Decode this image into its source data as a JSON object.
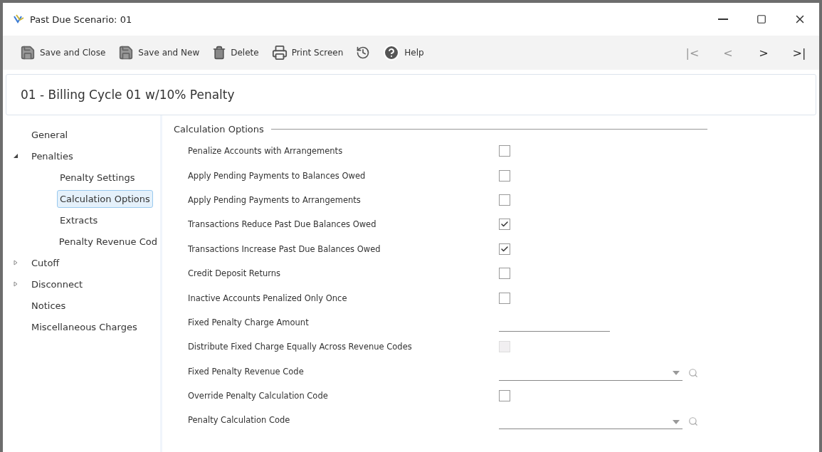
{
  "window": {
    "title": "Past Due Scenario: 01"
  },
  "toolbar": {
    "buttons": [
      {
        "kind": "save-close",
        "label": "Save and Close"
      },
      {
        "kind": "save-new",
        "label": "Save and New"
      },
      {
        "kind": "delete",
        "label": "Delete"
      },
      {
        "kind": "print",
        "label": "Print Screen"
      },
      {
        "kind": "history"
      },
      {
        "kind": "help",
        "label": "Help"
      }
    ],
    "navigation": [
      {
        "kind": "first",
        "label": "|<"
      },
      {
        "kind": "prev",
        "label": "<"
      },
      {
        "kind": "next",
        "label": ">"
      },
      {
        "kind": "last",
        "label": ">|"
      }
    ]
  },
  "record_title": "01 - Billing Cycle 01 w/10% Penalty",
  "sidebar": {
    "items": [
      {
        "label": "General",
        "selected": false
      },
      {
        "label": "Penalties",
        "selected": false,
        "expanded": true,
        "children": [
          {
            "label": "Penalty Settings",
            "selected": false
          },
          {
            "label": "Calculation Options",
            "selected": true
          },
          {
            "label": "Extracts",
            "selected": false
          },
          {
            "label": "Penalty Revenue Cod",
            "selected": false
          }
        ]
      },
      {
        "label": "Cutoff",
        "selected": false,
        "expanded": false
      },
      {
        "label": "Disconnect",
        "selected": false,
        "expanded": false
      },
      {
        "label": "Notices",
        "selected": false
      },
      {
        "label": "Miscellaneous Charges",
        "selected": false
      }
    ]
  },
  "section": {
    "title": "Calculation Options",
    "fields": [
      {
        "kind": "checkbox",
        "label": "Penalize Accounts with Arrangements",
        "checked": false,
        "disabled": false
      },
      {
        "kind": "checkbox",
        "label": "Apply Pending Payments to Balances Owed",
        "checked": false,
        "disabled": false
      },
      {
        "kind": "checkbox",
        "label": "Apply Pending Payments to Arrangements",
        "checked": false,
        "disabled": false
      },
      {
        "kind": "checkbox",
        "label": "Transactions Reduce Past Due Balances Owed",
        "checked": true,
        "disabled": false
      },
      {
        "kind": "checkbox",
        "label": "Transactions Increase Past Due Balances Owed",
        "checked": true,
        "disabled": false
      },
      {
        "kind": "checkbox",
        "label": "Credit Deposit Returns",
        "checked": false,
        "disabled": false
      },
      {
        "kind": "checkbox",
        "label": "Inactive Accounts Penalized Only Once",
        "checked": false,
        "disabled": false
      },
      {
        "kind": "text",
        "label": "Fixed Penalty Charge Amount"
      },
      {
        "kind": "checkbox",
        "label": "Distribute Fixed Charge Equally Across Revenue Codes",
        "checked": false,
        "disabled": true
      },
      {
        "kind": "lookup",
        "label": "Fixed Penalty Revenue Code"
      },
      {
        "kind": "checkbox",
        "label": "Override Penalty Calculation Code",
        "checked": false,
        "disabled": false
      },
      {
        "kind": "lookup",
        "label": "Penalty Calculation Code"
      }
    ]
  }
}
